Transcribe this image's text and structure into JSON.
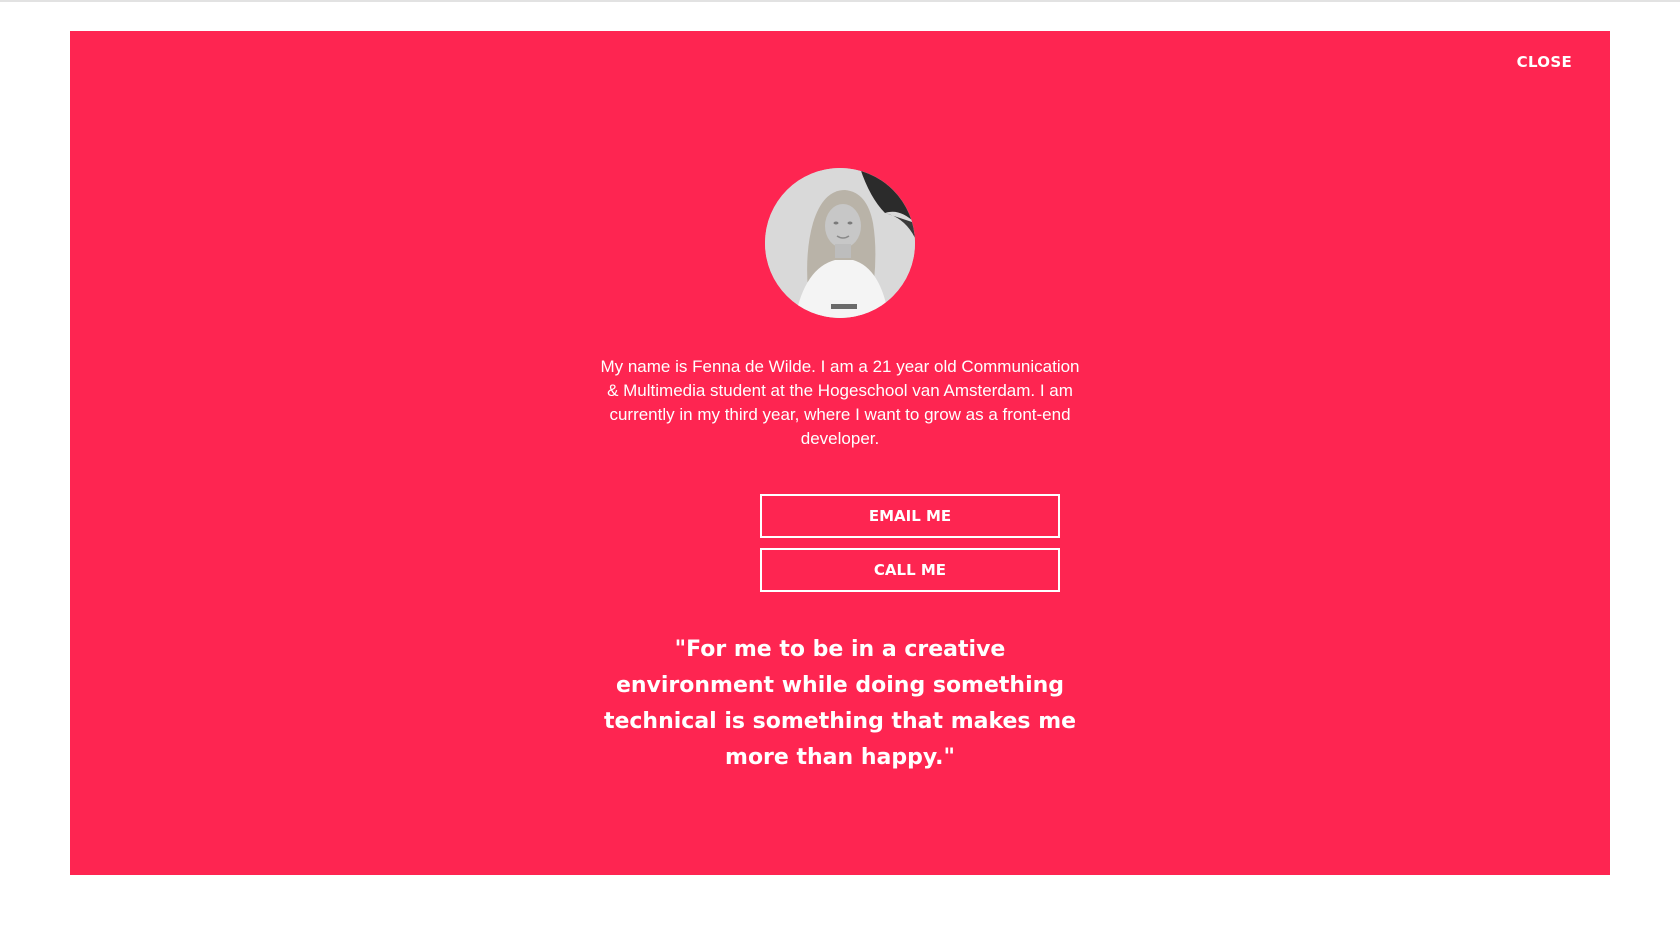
{
  "modal": {
    "background": "#fe2551",
    "close_label": "CLOSE",
    "avatar_alt": "avatar",
    "bio": "My name is Fenna de Wilde. I am a 21 year old Communication & Multimedia student at the Hogeschool van Amsterdam. I am currently in my third year, where I want to grow as a front-end developer.",
    "buttons": {
      "email_label": "EMAIL ME",
      "call_label": "CALL ME"
    },
    "quote": "\"For me to be in a creative environment while doing something technical is something that makes me more than happy.\""
  }
}
